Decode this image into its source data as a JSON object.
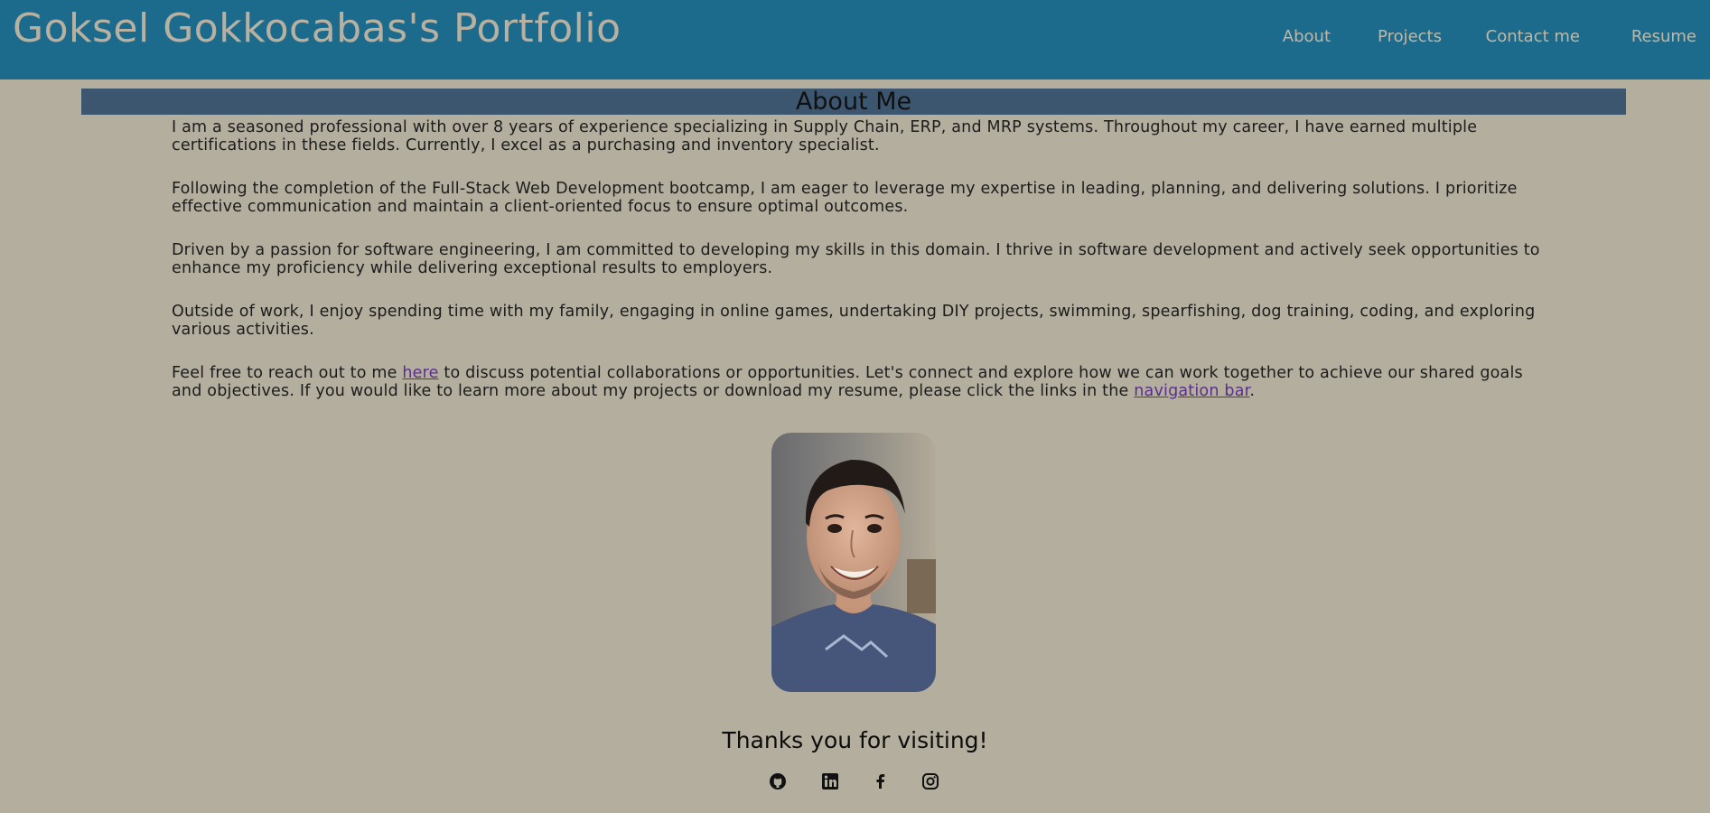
{
  "header": {
    "title": "Goksel Gokkocabas's Portfolio",
    "nav": [
      "About",
      "Projects",
      "Contact me",
      "Resume"
    ]
  },
  "about": {
    "heading": "About Me",
    "p1": "I am a seasoned professional with over 8 years of experience specializing in Supply Chain, ERP, and MRP systems. Throughout my career, I have earned multiple certifications in these fields. Currently, I excel as a purchasing and inventory specialist.",
    "p2": "Following the completion of the Full-Stack Web Development bootcamp, I am eager to leverage my expertise in leading, planning, and delivering solutions. I prioritize effective communication and maintain a client-oriented focus to ensure optimal outcomes.",
    "p3": "Driven by a passion for software engineering, I am committed to developing my skills in this domain. I thrive in software development and actively seek opportunities to enhance my proficiency while delivering exceptional results to employers.",
    "p4": "Outside of work, I enjoy spending time with my family, engaging in online games, undertaking DIY projects, swimming, spearfishing, dog training, coding, and exploring various activities.",
    "p5_before": "Feel free to reach out to me ",
    "p5_link1": "here",
    "p5_middle": " to discuss potential collaborations or opportunities. Let's connect and explore how we can work together to achieve our shared goals and objectives. If you would like to learn more about my projects or download my resume, please click the links in the ",
    "p5_link2": "navigation bar",
    "p5_after": "."
  },
  "footer": {
    "thanks": "Thanks you for visiting!",
    "socials": [
      "github-icon",
      "linkedin-icon",
      "facebook-icon",
      "instagram-icon"
    ]
  },
  "colors": {
    "header_bg": "#1d6b8c",
    "page_bg": "#b4ae9f",
    "about_bar_bg": "#3d5670",
    "link": "#5b2d8e"
  }
}
